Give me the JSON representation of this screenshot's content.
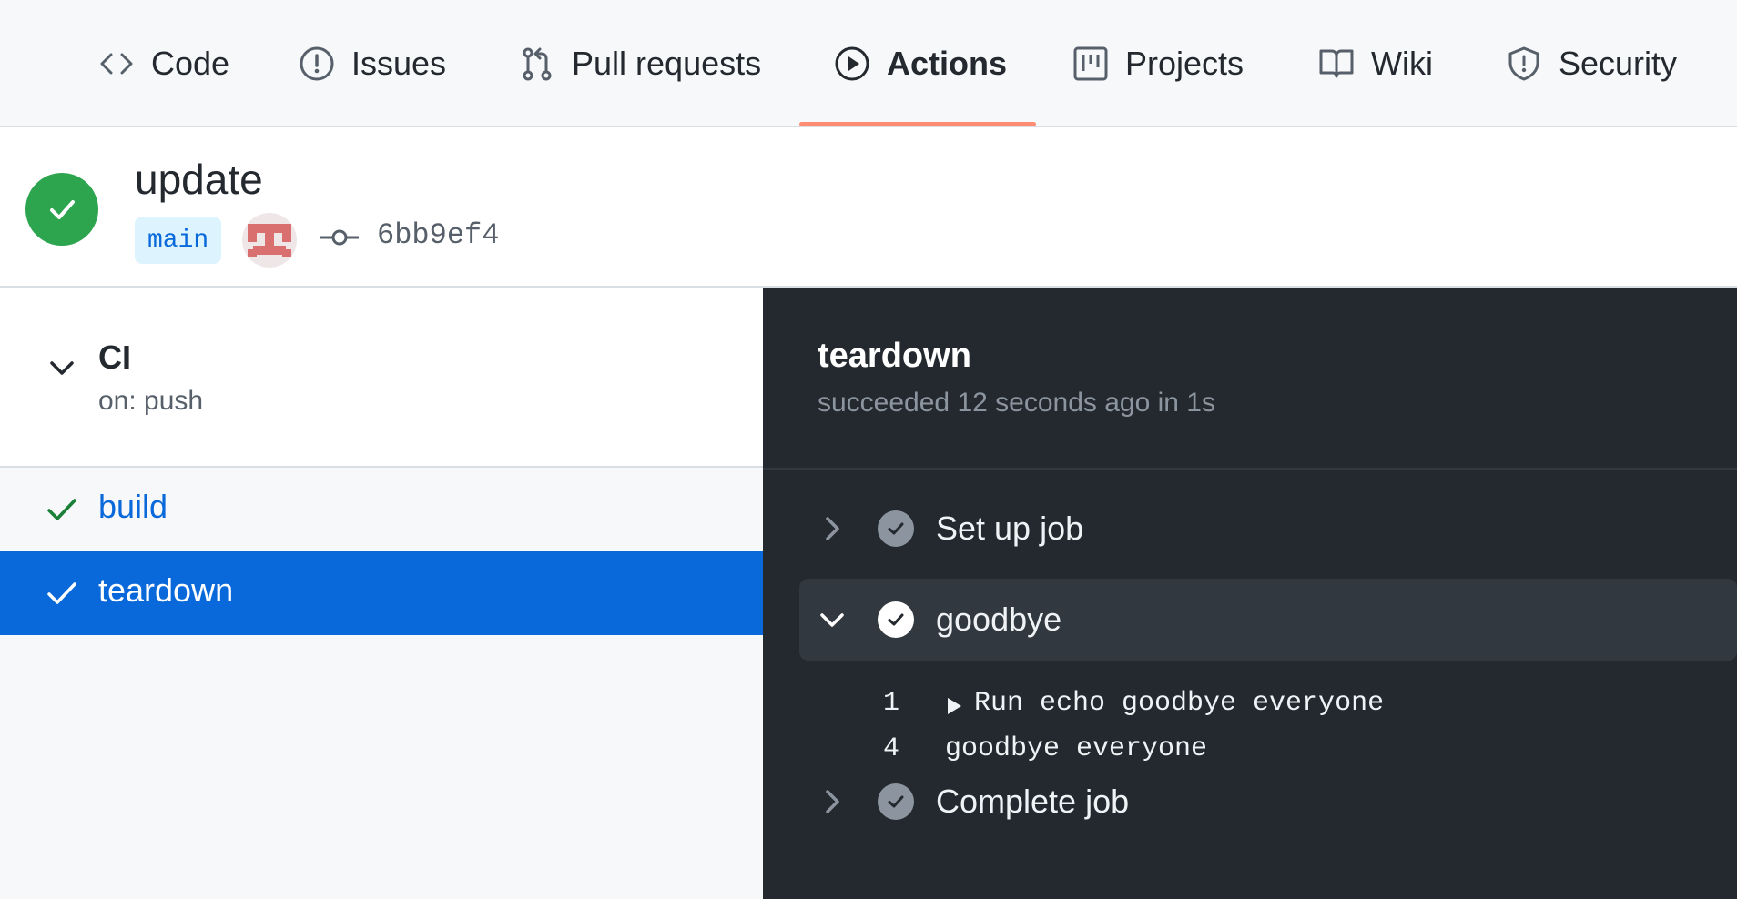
{
  "nav": {
    "tabs": [
      {
        "label": "Code",
        "icon": "code-icon"
      },
      {
        "label": "Issues",
        "icon": "issue-icon"
      },
      {
        "label": "Pull requests",
        "icon": "pull-request-icon"
      },
      {
        "label": "Actions",
        "icon": "play-icon",
        "active": true
      },
      {
        "label": "Projects",
        "icon": "project-icon"
      },
      {
        "label": "Wiki",
        "icon": "book-icon"
      },
      {
        "label": "Security",
        "icon": "shield-icon"
      }
    ]
  },
  "run": {
    "title": "update",
    "branch": "main",
    "commit_sha": "6bb9ef4",
    "status": "success"
  },
  "workflow": {
    "name": "CI",
    "trigger": "on: push",
    "jobs": [
      {
        "label": "build",
        "status": "success",
        "selected": false
      },
      {
        "label": "teardown",
        "status": "success",
        "selected": true
      }
    ]
  },
  "log": {
    "job_title": "teardown",
    "job_summary": "succeeded 12 seconds ago in 1s",
    "steps": [
      {
        "label": "Set up job",
        "expanded": false
      },
      {
        "label": "goodbye",
        "expanded": true
      },
      {
        "label": "Complete job",
        "expanded": false
      }
    ],
    "lines": [
      {
        "number": "1",
        "text": "Run echo goodbye everyone",
        "collapsible": true
      },
      {
        "number": "4",
        "text": "goodbye everyone",
        "collapsible": false
      }
    ]
  },
  "colors": {
    "success": "#2da44e",
    "accent": "#0969da",
    "tab_underline": "#fd8c73",
    "log_bg": "#24292f"
  }
}
